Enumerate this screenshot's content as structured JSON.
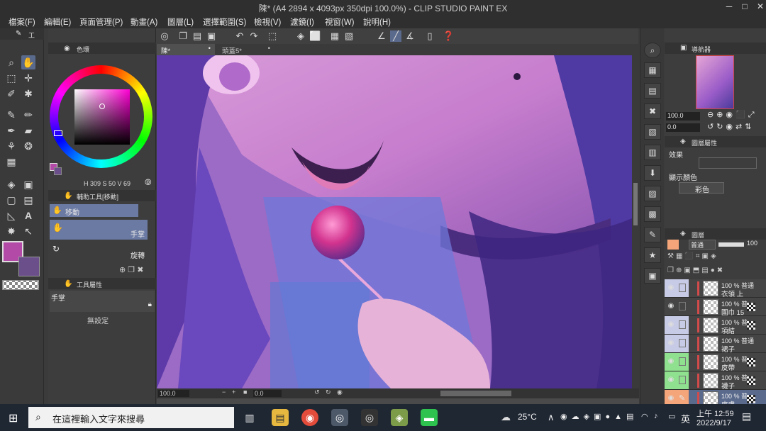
{
  "window": {
    "title": "陳* (A4 2894 x 4093px 350dpi 100.0%)  - CLIP STUDIO PAINT EX",
    "minimize": "─",
    "maximize": "□",
    "close": "✕"
  },
  "menu": [
    "檔案(F)",
    "編輯(E)",
    "頁面管理(P)",
    "動畫(A)",
    "圖層(L)",
    "選擇範圍(S)",
    "檢視(V)",
    "濾鏡(I)",
    "視窗(W)",
    "說明(H)"
  ],
  "toolbox": {
    "header": "工",
    "tools": [
      {
        "icon": "zoom-icon",
        "glyph": "⌕"
      },
      {
        "icon": "hand-icon",
        "glyph": "✋"
      },
      {
        "icon": "rect-select-icon",
        "glyph": "⬚"
      },
      {
        "icon": "move-icon",
        "glyph": "✛"
      },
      {
        "icon": "eyedropper-icon",
        "glyph": "✐"
      },
      {
        "icon": "magic-wand-icon",
        "glyph": "✱"
      },
      {
        "icon": "pen-icon",
        "glyph": "✎"
      },
      {
        "icon": "pencil-icon",
        "glyph": "✏"
      },
      {
        "icon": "brush-icon",
        "glyph": "✒"
      },
      {
        "icon": "eraser-icon",
        "glyph": "▰"
      },
      {
        "icon": "blend-icon",
        "glyph": "⚘"
      },
      {
        "icon": "airbrush-icon",
        "glyph": "❂"
      },
      {
        "icon": "frame-icon",
        "glyph": "▦"
      },
      {
        "icon": "fill-icon",
        "glyph": "◈"
      },
      {
        "icon": "gradient-icon",
        "glyph": "▣"
      },
      {
        "icon": "figure-icon",
        "glyph": "▢"
      },
      {
        "icon": "panel-icon",
        "glyph": "▤"
      },
      {
        "icon": "text-icon",
        "glyph": "A"
      },
      {
        "icon": "ruler-icon",
        "glyph": "◺"
      },
      {
        "icon": "correct-icon",
        "glyph": "↖"
      },
      {
        "icon": "decoration-icon",
        "glyph": "✸"
      },
      {
        "icon": "operation-icon",
        "glyph": "➤"
      }
    ],
    "main_color": "#b34aa8",
    "sub_color": "#6a4f8a"
  },
  "color_panel": {
    "header": "色環",
    "readout": "H 309  S 50  V 69"
  },
  "subtool_panel": {
    "header": "輔助工具[移動]",
    "items": [
      {
        "label": "移動",
        "selected": true
      },
      {
        "label": "手掌",
        "selected": true
      },
      {
        "label": "旋轉",
        "selected": false
      }
    ]
  },
  "tool_property": {
    "header": "工具屬性",
    "tool_name": "手掌",
    "value": "無設定"
  },
  "canvas": {
    "tabs": [
      {
        "label": "陳*",
        "active": true
      },
      {
        "label": "頭蓋5*",
        "active": false
      }
    ],
    "status_zoom": "100.0",
    "status_angle": "0.0"
  },
  "navigator": {
    "header": "導航器",
    "zoom": "100.0",
    "angle": "0.0"
  },
  "layer_property": {
    "header": "圖層屬性",
    "effect_label": "效果",
    "display_color_label": "顯示顏色",
    "display_color_value": "彩色"
  },
  "layer_panel": {
    "header": "圖層",
    "blend_mode": "普通",
    "opacity": "100",
    "layers": [
      {
        "mode": "100 % 普通",
        "name": "衣領 上",
        "bar": "#d24a4a",
        "sel_color": "#c8cbe6"
      },
      {
        "mode": "100 % 普",
        "name": "圍巾 15",
        "bar": "#d24a4a",
        "sel_color": "#454545"
      },
      {
        "mode": "100 % 普",
        "name": "項結",
        "bar": "#d24a4a",
        "sel_color": "#c8cbe6"
      },
      {
        "mode": "100 % 普通",
        "name": "裙子",
        "bar": "#d24a4a",
        "sel_color": "#c8cbe6"
      },
      {
        "mode": "100 % 普",
        "name": "皮帶",
        "bar": "#d24a4a",
        "sel_color": "#8fe08f"
      },
      {
        "mode": "100 % 普",
        "name": "襪子",
        "bar": "#d24a4a",
        "sel_color": "#8fe08f"
      },
      {
        "mode": "100 % 普",
        "name": "皮膚",
        "bar": "#d24a4a",
        "sel_color": "#f4a57a"
      }
    ]
  },
  "taskbar": {
    "search_placeholder": "在這裡輸入文字來搜尋",
    "weather": "25°C",
    "ime": "英",
    "time": "上午 12:59",
    "date": "2022/9/17"
  }
}
